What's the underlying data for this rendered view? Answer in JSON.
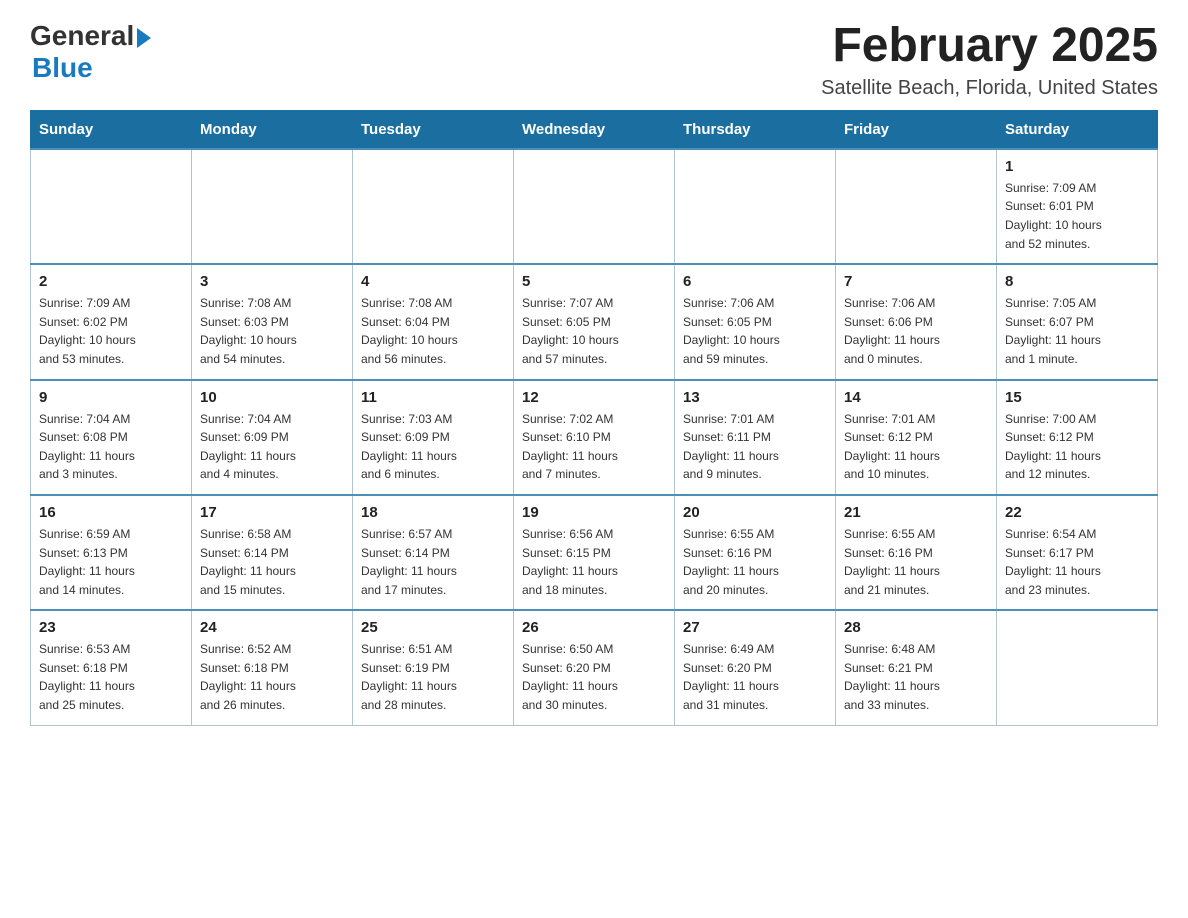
{
  "header": {
    "logo_general": "General",
    "logo_blue": "Blue",
    "month_title": "February 2025",
    "location": "Satellite Beach, Florida, United States"
  },
  "days_of_week": [
    "Sunday",
    "Monday",
    "Tuesday",
    "Wednesday",
    "Thursday",
    "Friday",
    "Saturday"
  ],
  "weeks": [
    [
      {
        "day": "",
        "info": ""
      },
      {
        "day": "",
        "info": ""
      },
      {
        "day": "",
        "info": ""
      },
      {
        "day": "",
        "info": ""
      },
      {
        "day": "",
        "info": ""
      },
      {
        "day": "",
        "info": ""
      },
      {
        "day": "1",
        "info": "Sunrise: 7:09 AM\nSunset: 6:01 PM\nDaylight: 10 hours\nand 52 minutes."
      }
    ],
    [
      {
        "day": "2",
        "info": "Sunrise: 7:09 AM\nSunset: 6:02 PM\nDaylight: 10 hours\nand 53 minutes."
      },
      {
        "day": "3",
        "info": "Sunrise: 7:08 AM\nSunset: 6:03 PM\nDaylight: 10 hours\nand 54 minutes."
      },
      {
        "day": "4",
        "info": "Sunrise: 7:08 AM\nSunset: 6:04 PM\nDaylight: 10 hours\nand 56 minutes."
      },
      {
        "day": "5",
        "info": "Sunrise: 7:07 AM\nSunset: 6:05 PM\nDaylight: 10 hours\nand 57 minutes."
      },
      {
        "day": "6",
        "info": "Sunrise: 7:06 AM\nSunset: 6:05 PM\nDaylight: 10 hours\nand 59 minutes."
      },
      {
        "day": "7",
        "info": "Sunrise: 7:06 AM\nSunset: 6:06 PM\nDaylight: 11 hours\nand 0 minutes."
      },
      {
        "day": "8",
        "info": "Sunrise: 7:05 AM\nSunset: 6:07 PM\nDaylight: 11 hours\nand 1 minute."
      }
    ],
    [
      {
        "day": "9",
        "info": "Sunrise: 7:04 AM\nSunset: 6:08 PM\nDaylight: 11 hours\nand 3 minutes."
      },
      {
        "day": "10",
        "info": "Sunrise: 7:04 AM\nSunset: 6:09 PM\nDaylight: 11 hours\nand 4 minutes."
      },
      {
        "day": "11",
        "info": "Sunrise: 7:03 AM\nSunset: 6:09 PM\nDaylight: 11 hours\nand 6 minutes."
      },
      {
        "day": "12",
        "info": "Sunrise: 7:02 AM\nSunset: 6:10 PM\nDaylight: 11 hours\nand 7 minutes."
      },
      {
        "day": "13",
        "info": "Sunrise: 7:01 AM\nSunset: 6:11 PM\nDaylight: 11 hours\nand 9 minutes."
      },
      {
        "day": "14",
        "info": "Sunrise: 7:01 AM\nSunset: 6:12 PM\nDaylight: 11 hours\nand 10 minutes."
      },
      {
        "day": "15",
        "info": "Sunrise: 7:00 AM\nSunset: 6:12 PM\nDaylight: 11 hours\nand 12 minutes."
      }
    ],
    [
      {
        "day": "16",
        "info": "Sunrise: 6:59 AM\nSunset: 6:13 PM\nDaylight: 11 hours\nand 14 minutes."
      },
      {
        "day": "17",
        "info": "Sunrise: 6:58 AM\nSunset: 6:14 PM\nDaylight: 11 hours\nand 15 minutes."
      },
      {
        "day": "18",
        "info": "Sunrise: 6:57 AM\nSunset: 6:14 PM\nDaylight: 11 hours\nand 17 minutes."
      },
      {
        "day": "19",
        "info": "Sunrise: 6:56 AM\nSunset: 6:15 PM\nDaylight: 11 hours\nand 18 minutes."
      },
      {
        "day": "20",
        "info": "Sunrise: 6:55 AM\nSunset: 6:16 PM\nDaylight: 11 hours\nand 20 minutes."
      },
      {
        "day": "21",
        "info": "Sunrise: 6:55 AM\nSunset: 6:16 PM\nDaylight: 11 hours\nand 21 minutes."
      },
      {
        "day": "22",
        "info": "Sunrise: 6:54 AM\nSunset: 6:17 PM\nDaylight: 11 hours\nand 23 minutes."
      }
    ],
    [
      {
        "day": "23",
        "info": "Sunrise: 6:53 AM\nSunset: 6:18 PM\nDaylight: 11 hours\nand 25 minutes."
      },
      {
        "day": "24",
        "info": "Sunrise: 6:52 AM\nSunset: 6:18 PM\nDaylight: 11 hours\nand 26 minutes."
      },
      {
        "day": "25",
        "info": "Sunrise: 6:51 AM\nSunset: 6:19 PM\nDaylight: 11 hours\nand 28 minutes."
      },
      {
        "day": "26",
        "info": "Sunrise: 6:50 AM\nSunset: 6:20 PM\nDaylight: 11 hours\nand 30 minutes."
      },
      {
        "day": "27",
        "info": "Sunrise: 6:49 AM\nSunset: 6:20 PM\nDaylight: 11 hours\nand 31 minutes."
      },
      {
        "day": "28",
        "info": "Sunrise: 6:48 AM\nSunset: 6:21 PM\nDaylight: 11 hours\nand 33 minutes."
      },
      {
        "day": "",
        "info": ""
      }
    ]
  ]
}
